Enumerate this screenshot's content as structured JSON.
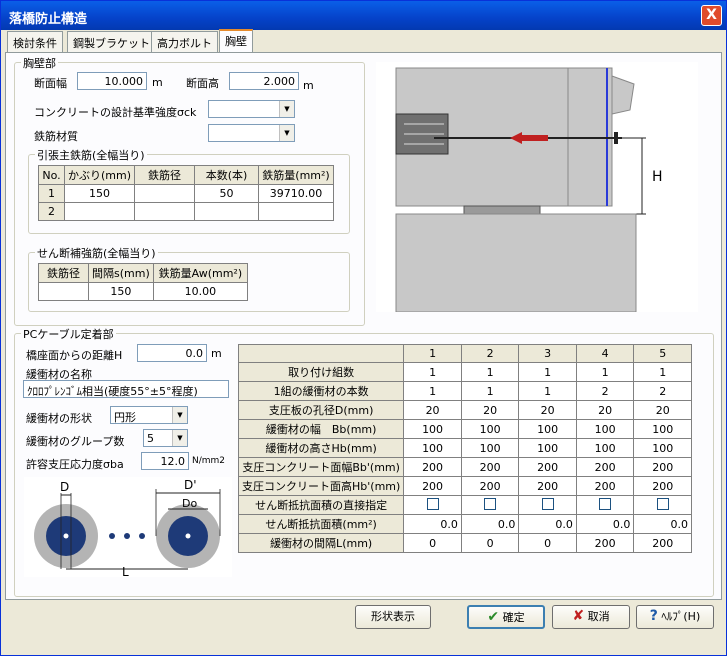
{
  "window": {
    "title": "落橋防止構造",
    "close_label": "X"
  },
  "tabs": [
    {
      "label": "検討条件"
    },
    {
      "label": "鋼製ブラケット"
    },
    {
      "label": "高力ボルト"
    },
    {
      "label": "胸壁"
    }
  ],
  "kyouheki": {
    "group_label": "胸壁部",
    "width_label": "断面幅",
    "width_value": "10.000",
    "width_unit": "m",
    "height_label": "断面高",
    "height_value": "2.000",
    "height_unit": "m",
    "concrete_label": "コンクリートの設計基準強度σck",
    "concrete_value": "",
    "rebar_material_label": "鉄筋材質",
    "rebar_material_value": ""
  },
  "tension": {
    "group_label": "引張主鉄筋(全幅当り)",
    "headers": [
      "No.",
      "かぶり(mm)",
      "鉄筋径",
      "本数(本)",
      "鉄筋量(mm²)"
    ],
    "rows": [
      [
        "1",
        "150",
        "",
        "50",
        "39710.00"
      ],
      [
        "2",
        "",
        "",
        "",
        ""
      ]
    ]
  },
  "shear": {
    "group_label": "せん断補強筋(全幅当り)",
    "headers": [
      "鉄筋径",
      "間隔s(mm)",
      "鉄筋量Aw(mm²)"
    ],
    "row": [
      "",
      "150",
      "10.00"
    ]
  },
  "figure_top": {
    "label_H": "H"
  },
  "pc": {
    "group_label": "PCケーブル定着部",
    "distance_label": "橋座面からの距離H",
    "distance_value": "0.0",
    "distance_unit": "m",
    "cushion_name_label": "緩衝材の名称",
    "cushion_name_value": "ｸﾛﾛﾌﾟﾚﾝｺﾞﾑ相当(硬度55°±5°程度)",
    "shape_label": "緩衝材の形状",
    "shape_value": "円形",
    "groups_label": "緩衝材のグループ数",
    "groups_value": "5",
    "allow_label": "許容支圧応力度σba",
    "allow_value": "12.0",
    "allow_unit": "N/mm2",
    "fig": {
      "D": "D",
      "Dprime": "D'",
      "Do": "Do",
      "L": "L"
    }
  },
  "grid": {
    "cols": [
      "1",
      "2",
      "3",
      "4",
      "5"
    ],
    "rows": [
      {
        "label": "取り付け組数",
        "values": [
          "1",
          "1",
          "1",
          "1",
          "1"
        ]
      },
      {
        "label": "1組の緩衝材の本数",
        "values": [
          "1",
          "1",
          "1",
          "2",
          "2"
        ]
      },
      {
        "label": "支圧板の孔径D(mm)",
        "values": [
          "20",
          "20",
          "20",
          "20",
          "20"
        ]
      },
      {
        "label": "緩衝材の幅　Bb(mm)",
        "values": [
          "100",
          "100",
          "100",
          "100",
          "100"
        ]
      },
      {
        "label": "緩衝材の高さHb(mm)",
        "values": [
          "100",
          "100",
          "100",
          "100",
          "100"
        ]
      },
      {
        "label": "支圧コンクリート面幅Bb'(mm)",
        "values": [
          "200",
          "200",
          "200",
          "200",
          "200"
        ]
      },
      {
        "label": "支圧コンクリート面高Hb'(mm)",
        "values": [
          "200",
          "200",
          "200",
          "200",
          "200"
        ]
      },
      {
        "label": "せん断抵抗面積の直接指定",
        "checks": [
          false,
          false,
          false,
          false,
          false
        ]
      },
      {
        "label": "せん断抵抗面積(mm²)",
        "values": [
          "0.0",
          "0.0",
          "0.0",
          "0.0",
          "0.0"
        ]
      },
      {
        "label": "緩衝材の間隔L(mm)",
        "values": [
          "0",
          "0",
          "0",
          "200",
          "200"
        ]
      }
    ]
  },
  "buttons": {
    "shape": "形状表示",
    "ok": "確定",
    "cancel": "取消",
    "help": "ﾍﾙﾌﾟ(H)"
  },
  "colors": {
    "titlebar": "#0542c9",
    "arrow": "#c02020",
    "cushion_dark": "#1e3a78"
  }
}
